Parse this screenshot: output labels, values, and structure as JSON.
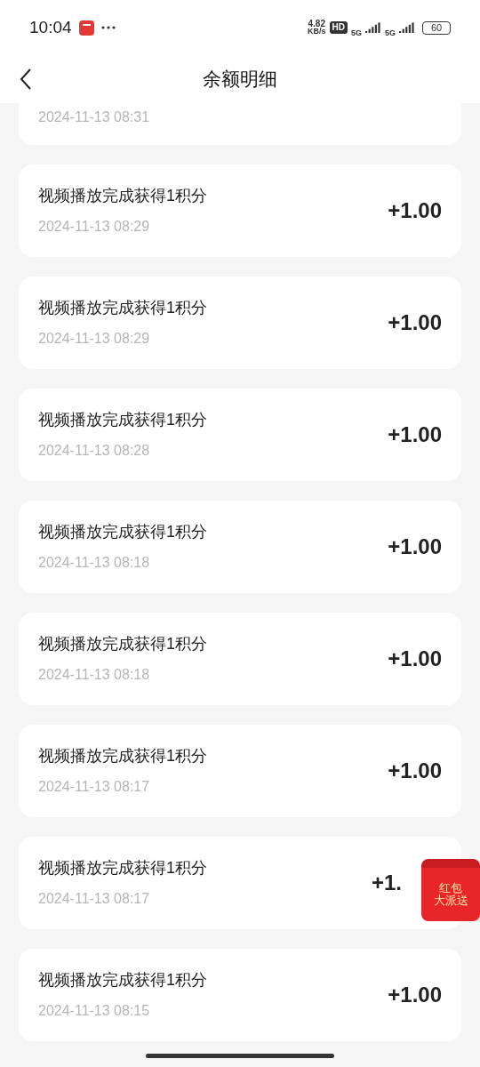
{
  "status_bar": {
    "time": "10:04",
    "speed_value": "4.82",
    "speed_unit": "KB/s",
    "hd": "HD",
    "sim1": "5G",
    "sim2": "5G",
    "battery": "60"
  },
  "header": {
    "title": "余额明细"
  },
  "top_partial": {
    "date": "2024-11-13 08:31"
  },
  "records": [
    {
      "title": "视频播放完成获得1积分",
      "date": "2024-11-13 08:29",
      "amount": "+1.00"
    },
    {
      "title": "视频播放完成获得1积分",
      "date": "2024-11-13 08:29",
      "amount": "+1.00"
    },
    {
      "title": "视频播放完成获得1积分",
      "date": "2024-11-13 08:28",
      "amount": "+1.00"
    },
    {
      "title": "视频播放完成获得1积分",
      "date": "2024-11-13 08:18",
      "amount": "+1.00"
    },
    {
      "title": "视频播放完成获得1积分",
      "date": "2024-11-13 08:18",
      "amount": "+1.00"
    },
    {
      "title": "视频播放完成获得1积分",
      "date": "2024-11-13 08:17",
      "amount": "+1.00"
    },
    {
      "title": "视频播放完成获得1积分",
      "date": "2024-11-13 08:17",
      "amount": "+1.",
      "floating_badge": {
        "line1": "红包",
        "line2": "大派送"
      }
    },
    {
      "title": "视频播放完成获得1积分",
      "date": "2024-11-13 08:15",
      "amount": "+1.00"
    }
  ]
}
